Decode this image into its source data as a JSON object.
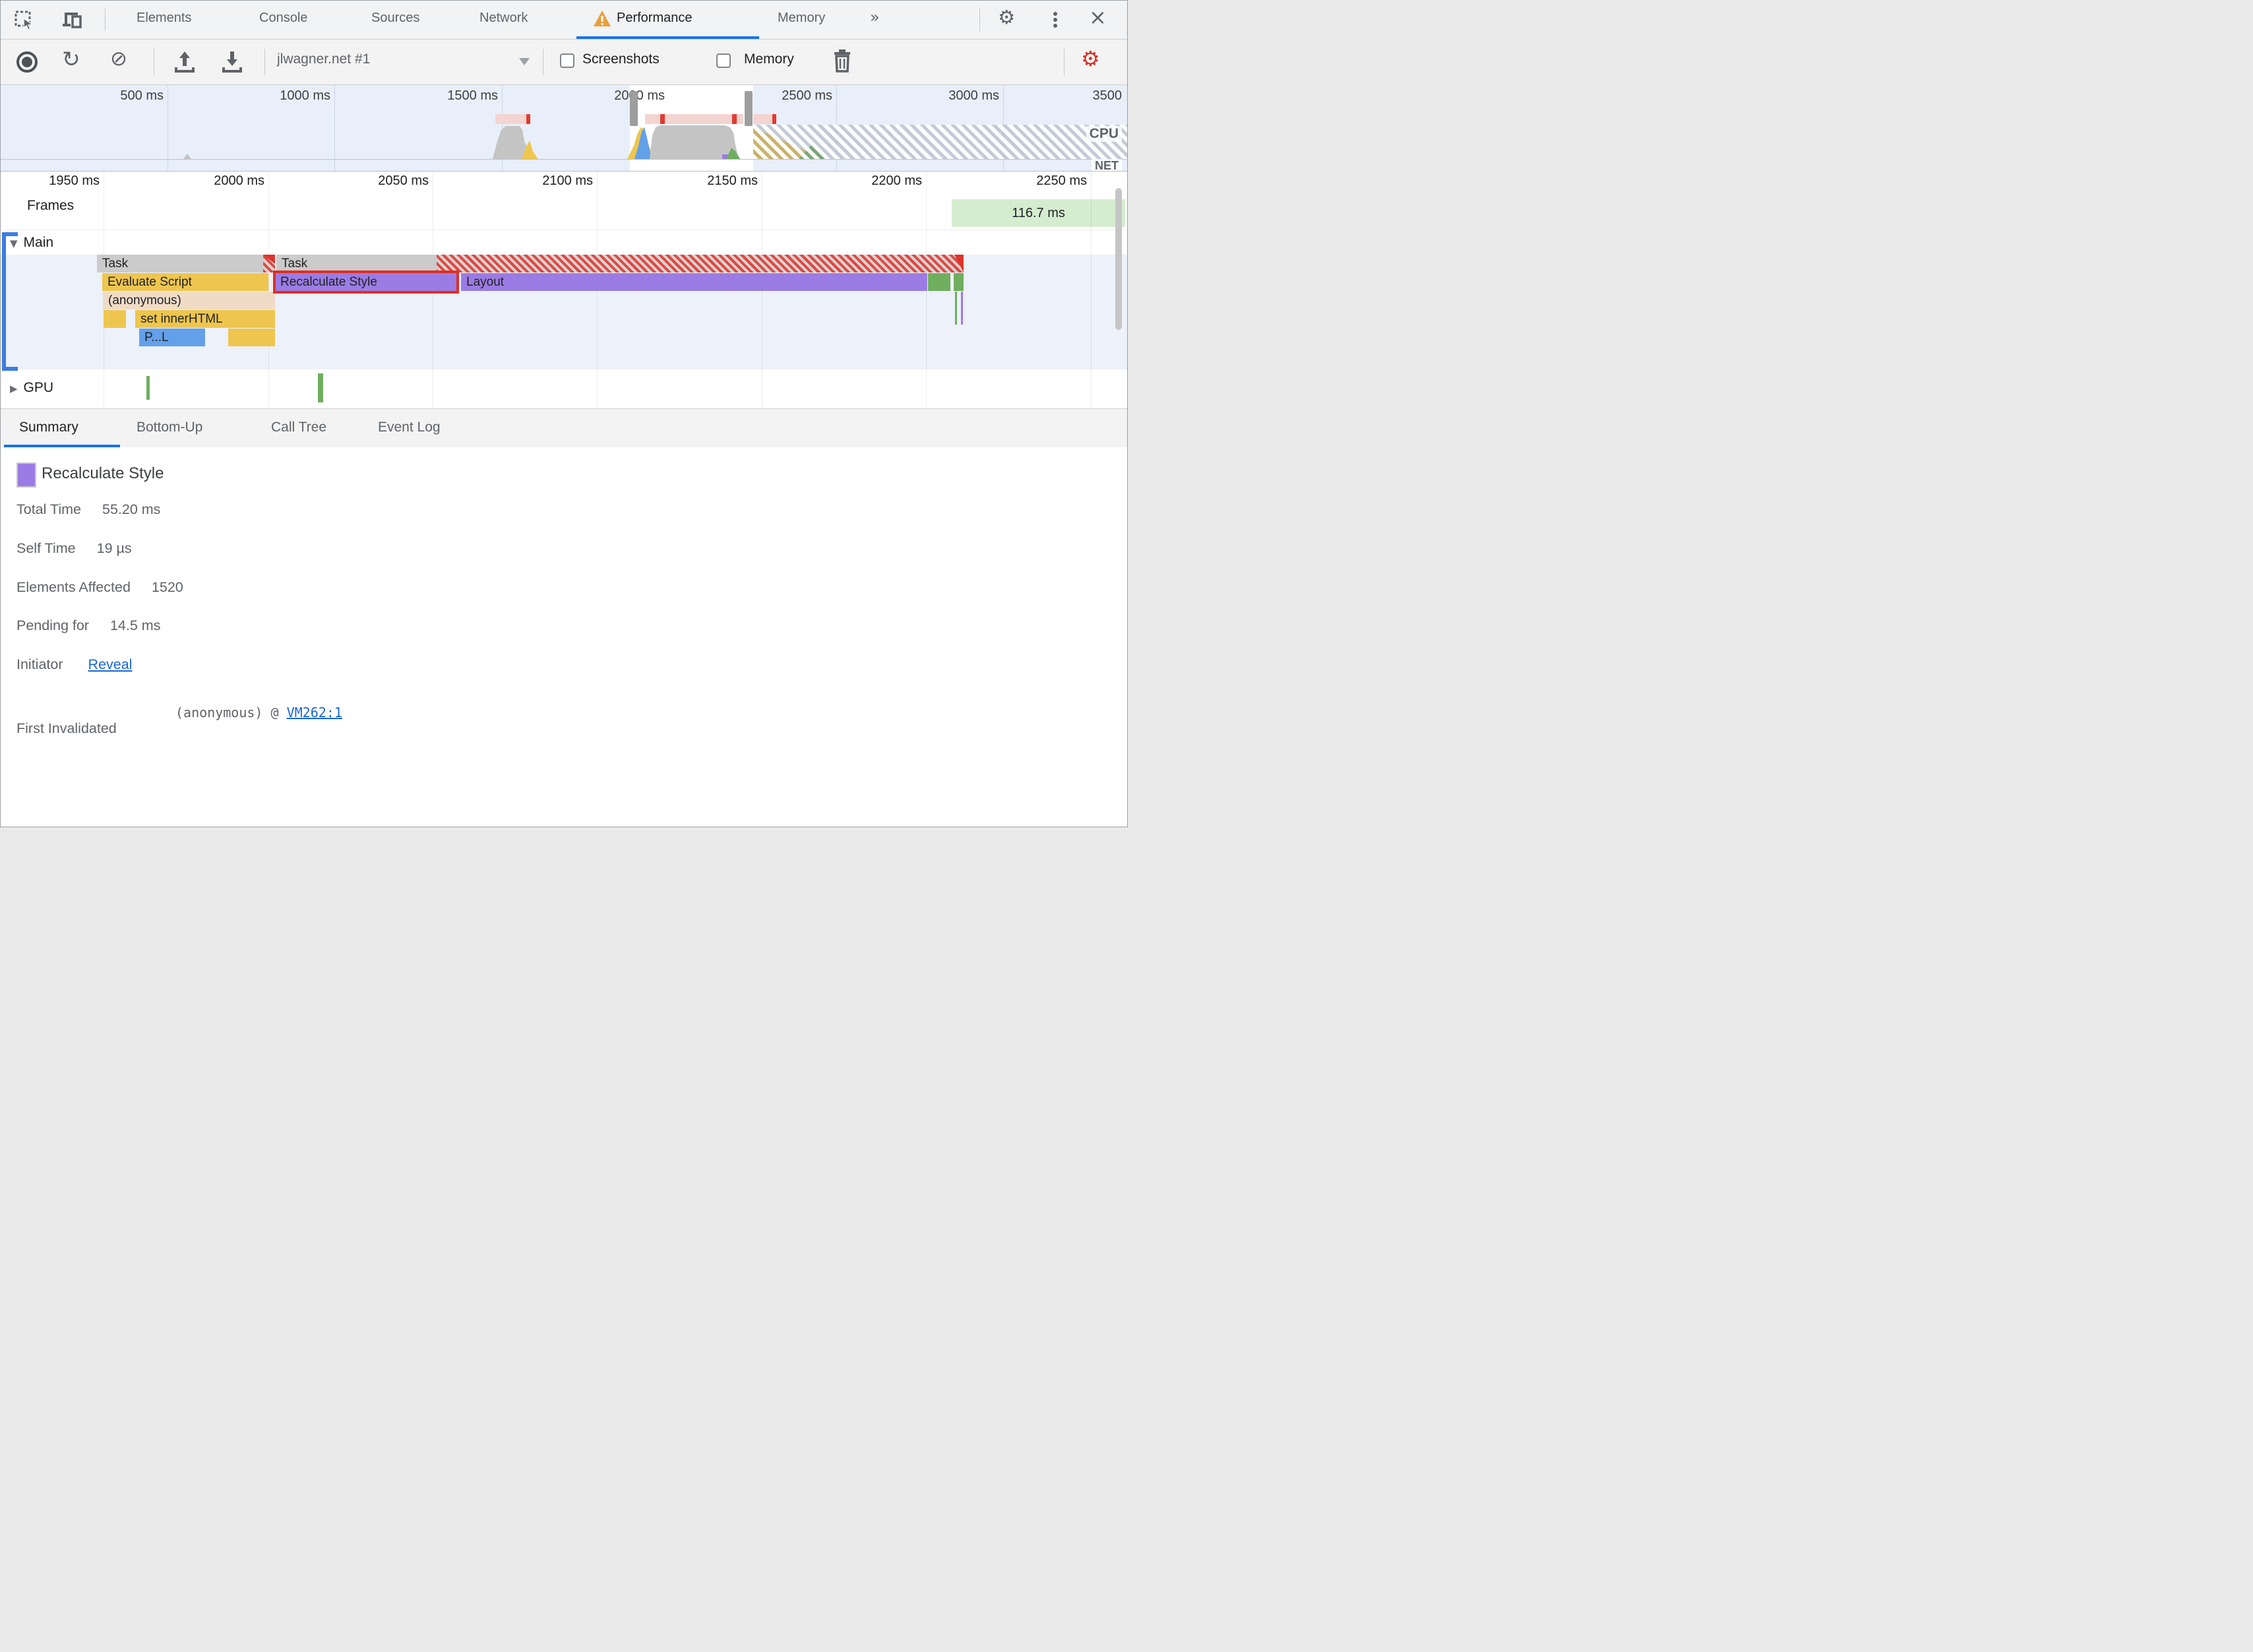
{
  "window": {
    "close_glyph": "×",
    "more_tabs_glyph": "»"
  },
  "devtools_tabs": {
    "items": [
      {
        "label": "Elements"
      },
      {
        "label": "Console"
      },
      {
        "label": "Sources"
      },
      {
        "label": "Network"
      },
      {
        "label": "Performance",
        "active": true,
        "warning": true
      },
      {
        "label": "Memory"
      }
    ]
  },
  "toolbar": {
    "session": "jlwagner.net #1",
    "screenshots_label": "Screenshots",
    "memory_label": "Memory"
  },
  "overview": {
    "ticks": [
      "500 ms",
      "1000 ms",
      "1500 ms",
      "2000 ms",
      "2500 ms",
      "3000 ms",
      "3500"
    ],
    "cpu_label": "CPU",
    "net_label": "NET"
  },
  "ruler": {
    "ticks": [
      "1950 ms",
      "2000 ms",
      "2050 ms",
      "2100 ms",
      "2150 ms",
      "2200 ms",
      "2250 ms"
    ]
  },
  "tracks": {
    "frames_label": "Frames",
    "frame_duration": "116.7 ms",
    "main_label": "Main",
    "gpu_label": "GPU"
  },
  "flame": {
    "task_a": "Task",
    "task_b": "Task",
    "evaluate_script": "Evaluate Script",
    "recalculate_style": "Recalculate Style",
    "layout": "Layout",
    "anonymous": "(anonymous)",
    "set_inner_html": "set innerHTML",
    "parse_truncated": "P...L"
  },
  "bottom_tabs": {
    "items": [
      "Summary",
      "Bottom-Up",
      "Call Tree",
      "Event Log"
    ]
  },
  "summary": {
    "title": "Recalculate Style",
    "rows": [
      {
        "label": "Total Time",
        "value": "55.20 ms"
      },
      {
        "label": "Self Time",
        "value": "19 µs"
      },
      {
        "label": "Elements Affected",
        "value": "1520"
      },
      {
        "label": "Pending for",
        "value": "14.5 ms"
      }
    ],
    "initiator_label": "Initiator",
    "initiator_link": "Reveal",
    "first_invalidated_label": "First Invalidated",
    "stack_text": "(anonymous) @ ",
    "stack_link": "VM262:1"
  },
  "colors": {
    "accent_blue": "#1a73e8",
    "warning_orange": "#e8a03c",
    "record_gear_red": "#d93025",
    "scripting_yellow": "#eec64f",
    "rendering_purple": "#9b7ce4",
    "painting_green": "#6fae5f",
    "task_gray": "#cbcbcb",
    "anonymous_beige": "#f0dcc6",
    "parse_blue": "#63a0ea",
    "frame_green": "#d5edcf",
    "long_task_red": "#de342a",
    "link_blue": "#1967d2"
  }
}
